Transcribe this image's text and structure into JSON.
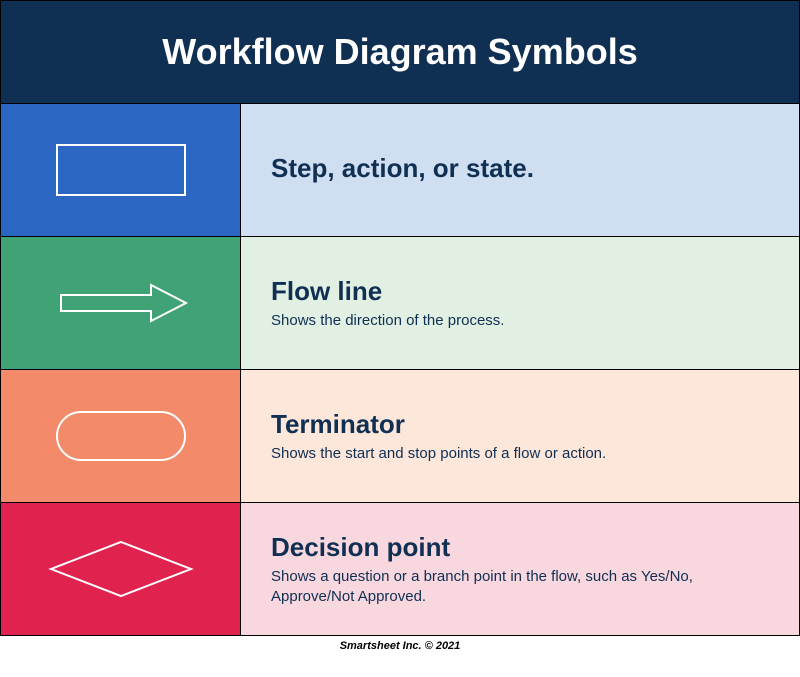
{
  "title": "Workflow Diagram Symbols",
  "rows": [
    {
      "title": "Step, action, or state.",
      "sub": ""
    },
    {
      "title": "Flow line",
      "sub": "Shows the direction of the process."
    },
    {
      "title": "Terminator",
      "sub": "Shows the start and stop points of a flow or action."
    },
    {
      "title": "Decision point",
      "sub": "Shows a question or a branch point in the flow, such as Yes/No, Approve/Not Approved."
    }
  ],
  "footer": "Smartsheet Inc. © 2021"
}
